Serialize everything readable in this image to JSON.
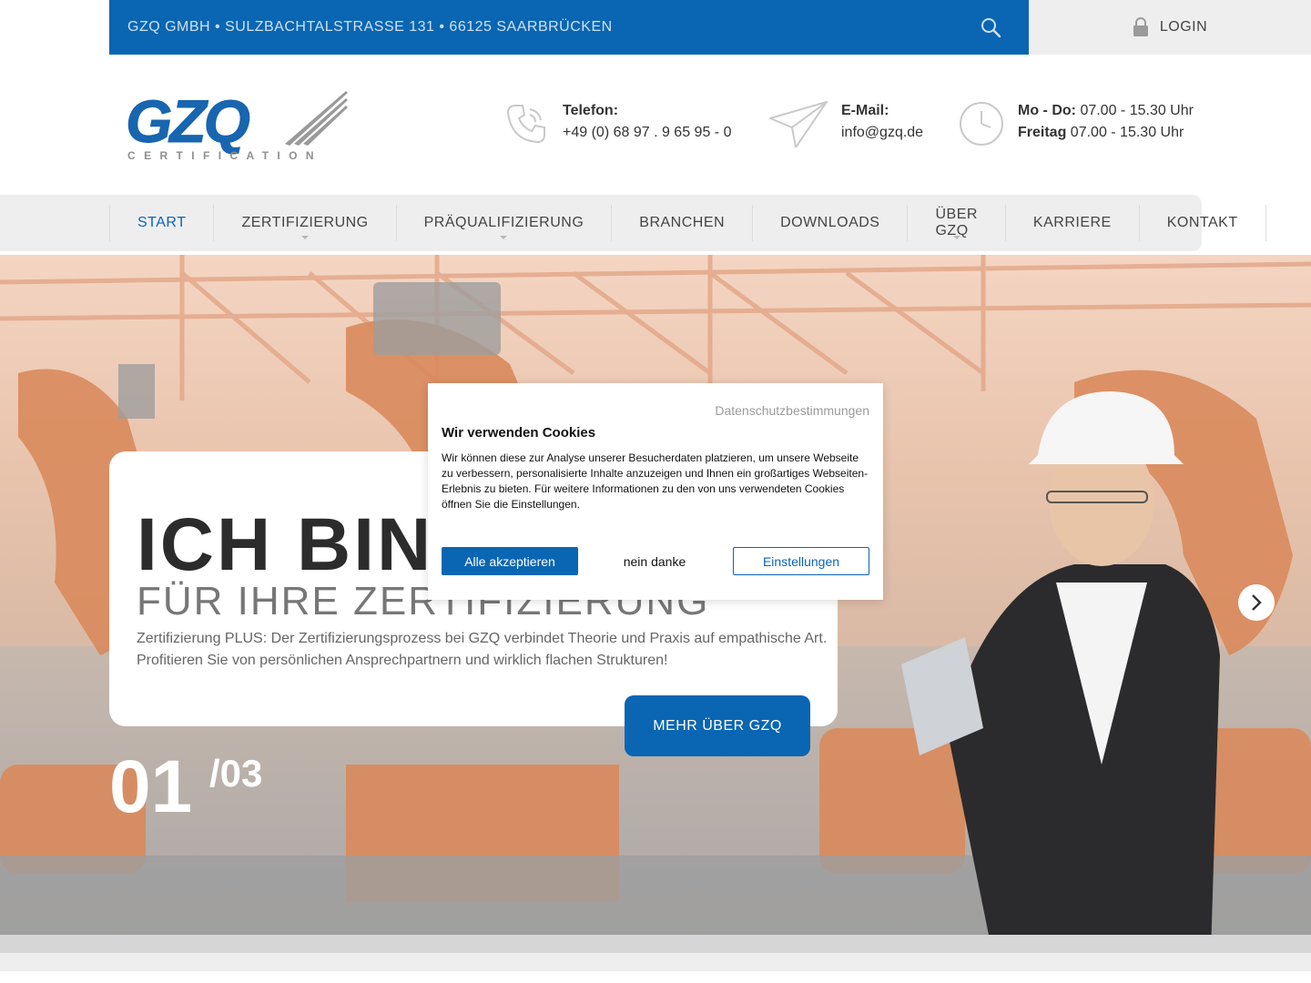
{
  "topbar": {
    "address": "GZQ GMBH • SULZBACHTALSTRASSE 131 • 66125 SAARBRÜCKEN",
    "login": "LOGIN"
  },
  "logo": {
    "text": "GZQ",
    "subtitle": "CERTIFICATION"
  },
  "contact": {
    "phone_label": "Telefon:",
    "phone_value": "+49 (0) 68 97 . 9 65 95 - 0",
    "email_label": "E-Mail:",
    "email_value": "info@gzq.de",
    "hours_label1": "Mo - Do:",
    "hours_value1": "07.00 - 15.30 Uhr",
    "hours_label2": "Freitag",
    "hours_value2": "07.00 - 15.30 Uhr"
  },
  "nav": {
    "items": [
      {
        "label": "START"
      },
      {
        "label": "ZERTIFIZIERUNG"
      },
      {
        "label": "PRÄQUALIFIZIERUNG"
      },
      {
        "label": "BRANCHEN"
      },
      {
        "label": "DOWNLOADS"
      },
      {
        "label": "ÜBER GZQ"
      },
      {
        "label": "KARRIERE"
      },
      {
        "label": "KONTAKT"
      }
    ]
  },
  "hero": {
    "headline": "ICH BIN I",
    "subheadline": "FÜR IHRE ZERTIFIZIERUNG",
    "text": "Zertifizierung PLUS: Der Zertifizierungsprozess bei GZQ verbindet Theorie und Praxis auf empathische Art. Profitieren Sie von persönlichen Ansprechpartnern und wirklich flachen Strukturen!",
    "button": "MEHR ÜBER GZQ",
    "slide_current": "01",
    "slide_total": "/03"
  },
  "cookie": {
    "policy_link": "Datenschutzbestimmungen",
    "title": "Wir verwenden Cookies",
    "body": "Wir können diese zur Analyse unserer Besucherdaten platzieren, um unsere Webseite zu verbessern, personalisierte Inhalte anzuzeigen und Ihnen ein großartiges Webseiten-Erlebnis zu bieten. Für weitere Informationen zu den von uns verwendeten Cookies öffnen Sie die Einstellungen.",
    "accept": "Alle akzeptieren",
    "decline": "nein danke",
    "settings": "Einstellungen"
  },
  "colors": {
    "brand_blue": "#0a66b2",
    "nav_bg": "#eeeeee"
  }
}
